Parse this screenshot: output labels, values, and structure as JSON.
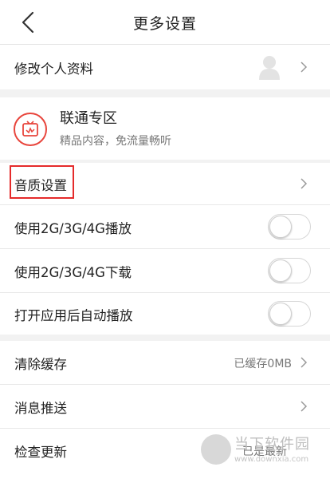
{
  "header": {
    "title": "更多设置",
    "back_icon": "back-arrow-icon"
  },
  "profile": {
    "label": "修改个人资料",
    "avatar_icon": "default-avatar-icon"
  },
  "unicom_zone": {
    "title": "联通专区",
    "subtitle": "精品内容，免流量畅听",
    "icon": "unicom-zone-icon",
    "accent": "#e8453c"
  },
  "settings": {
    "audio_quality": {
      "label": "音质设置"
    },
    "play_on_mobile": {
      "label": "使用2G/3G/4G播放",
      "enabled": false
    },
    "download_on_mobile": {
      "label": "使用2G/3G/4G下载",
      "enabled": false
    },
    "autoplay_on_launch": {
      "label": "打开应用后自动播放",
      "enabled": false
    }
  },
  "misc": {
    "clear_cache": {
      "label": "清除缓存",
      "value": "已缓存0MB"
    },
    "push_messages": {
      "label": "消息推送"
    },
    "check_update": {
      "label": "检查更新",
      "value": "已是最新"
    }
  },
  "watermark": {
    "name": "当下软件园",
    "url": "www.downxia.com"
  },
  "colors": {
    "highlight": "#e52b2b",
    "background": "#f2f2f2"
  }
}
